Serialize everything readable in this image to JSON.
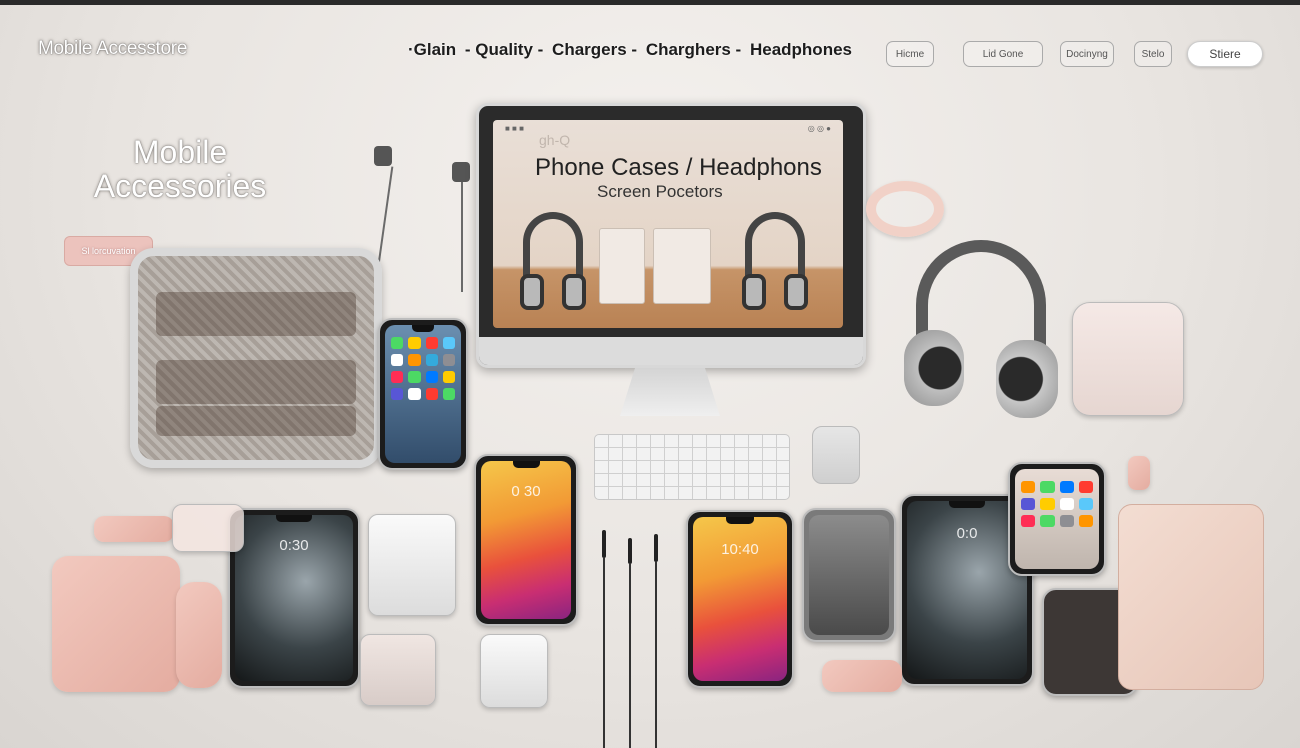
{
  "header": {
    "logo": "Mobile Accesstore",
    "nav": [
      "·Glain",
      "- Quality -",
      "Chargers -",
      "Charghers -",
      "Headphones"
    ],
    "pills": [
      "Hicme",
      "Lid Gone",
      "Docinyng",
      "Stelo",
      "Stiere"
    ]
  },
  "hero": {
    "title_line1": "Mobile",
    "title_line2": "Accessories",
    "cta_label": "Sl lorcuvation"
  },
  "monitor": {
    "watermark": "gh-Q",
    "title": "Phone Cases / Headphons",
    "subtitle": "Screen Pocetors",
    "status_left": "■ ■ ■",
    "status_right": "◎ ◎ ●"
  },
  "phones": {
    "clock_a": "0:30",
    "clock_b": "0 30",
    "clock_c": "10:40",
    "clock_d": "0:0"
  },
  "colors": {
    "accent_pink": "#ecc3bd",
    "background": "#ece8e4"
  }
}
